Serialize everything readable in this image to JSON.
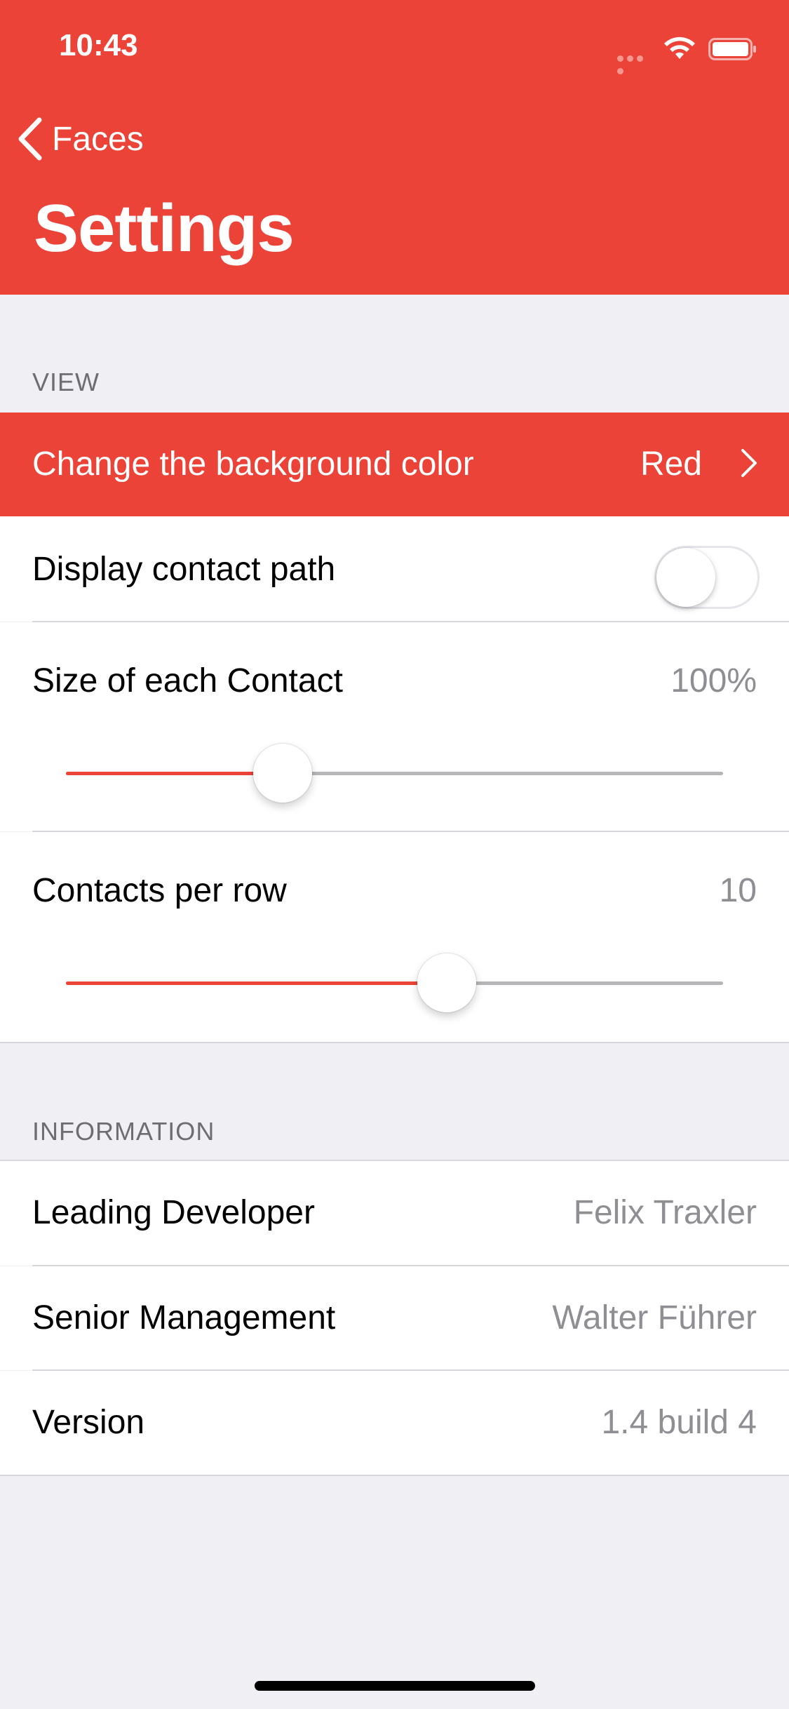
{
  "status_bar": {
    "time": "10:43"
  },
  "nav": {
    "back_label": "Faces",
    "title": "Settings"
  },
  "sections": {
    "view": {
      "header": "VIEW",
      "background_color": {
        "label": "Change the background color",
        "value": "Red"
      },
      "display_contact_path": {
        "label": "Display contact path",
        "on": false
      },
      "contact_size": {
        "label": "Size of each Contact",
        "value": "100%",
        "slider_fraction": 0.33
      },
      "contacts_per_row": {
        "label": "Contacts per row",
        "value": "10",
        "slider_fraction": 0.58
      }
    },
    "information": {
      "header": "INFORMATION",
      "rows": [
        {
          "label": "Leading Developer",
          "value": "Felix Traxler"
        },
        {
          "label": "Senior Management",
          "value": "Walter Führer"
        },
        {
          "label": "Version",
          "value": "1.4 build 4"
        }
      ]
    }
  },
  "colors": {
    "accent": "#EC4338",
    "background": "#EFEFF4",
    "secondary_text": "#8E8E93"
  }
}
